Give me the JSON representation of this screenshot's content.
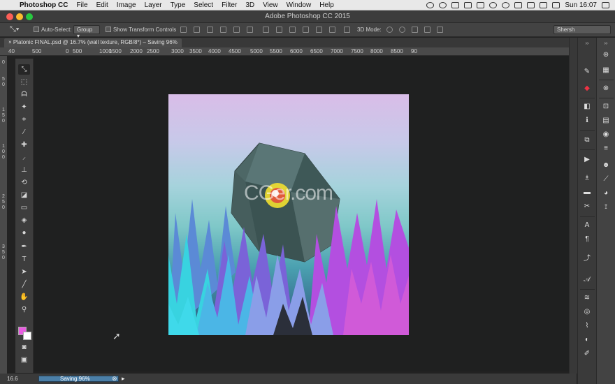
{
  "menubar": {
    "app": "Photoshop CC",
    "items": [
      "File",
      "Edit",
      "Image",
      "Layer",
      "Type",
      "Select",
      "Filter",
      "3D",
      "View",
      "Window",
      "Help"
    ],
    "clock": "Sun 16:07"
  },
  "window": {
    "title": "Adobe Photoshop CC 2015"
  },
  "options": {
    "auto_select_label": "Auto-Select:",
    "auto_select_value": "Group",
    "transform_label": "Show Transform Controls",
    "mode_label": "3D Mode:",
    "workspace_value": "Shersh"
  },
  "document": {
    "tab_label": "Platonic FINAL.psd @ 16.7% (wall texture, RGB/8*) – Saving 96%",
    "zoom": "16.6",
    "status": "Saving 96%",
    "progress": 0.96
  },
  "ruler": {
    "top_ticks": [
      "40",
      "500",
      "0",
      "500",
      "1000",
      "1500",
      "2000",
      "2500",
      "3000",
      "3500",
      "4000",
      "4500",
      "5000",
      "5500",
      "6000",
      "6500",
      "7000",
      "7500",
      "8000",
      "8500",
      "90"
    ],
    "left_ticks": [
      "0",
      "5",
      "0",
      "1",
      "5",
      "0",
      "1",
      "0",
      "0",
      "2",
      "5",
      "0",
      "3",
      "5",
      "0"
    ]
  },
  "artwork": {
    "watermark": "CGer.com"
  },
  "colors": {
    "foreground": "#e85ce0",
    "background": "#ffffff",
    "accent": "#4b7fa8"
  }
}
